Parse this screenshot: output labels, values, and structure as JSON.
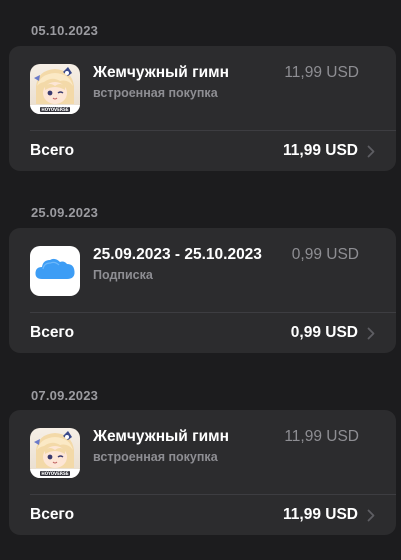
{
  "purchases": [
    {
      "date": "05.10.2023",
      "item_title": "Жемчужный гимн",
      "item_subtitle": "встроенная покупка",
      "item_price": "11,99 USD",
      "icon": "genshin-app-icon",
      "icon_caption": "HOYOVERSE",
      "total_label": "Всего",
      "total_price": "11,99 USD"
    },
    {
      "date": "25.09.2023",
      "item_title": "25.09.2023 - 25.10.2023",
      "item_subtitle": "Подписка",
      "item_price": "0,99 USD",
      "icon": "icloud-app-icon",
      "total_label": "Всего",
      "total_price": "0,99 USD"
    },
    {
      "date": "07.09.2023",
      "item_title": "Жемчужный гимн",
      "item_subtitle": "встроенная покупка",
      "item_price": "11,99 USD",
      "icon": "genshin-app-icon",
      "icon_caption": "HOYOVERSE",
      "total_label": "Всего",
      "total_price": "11,99 USD"
    }
  ],
  "colors": {
    "background": "#1c1c1e",
    "card": "#2c2c2e",
    "secondary_text": "#8e8e93",
    "icloud_blue": "#3d9df5"
  }
}
